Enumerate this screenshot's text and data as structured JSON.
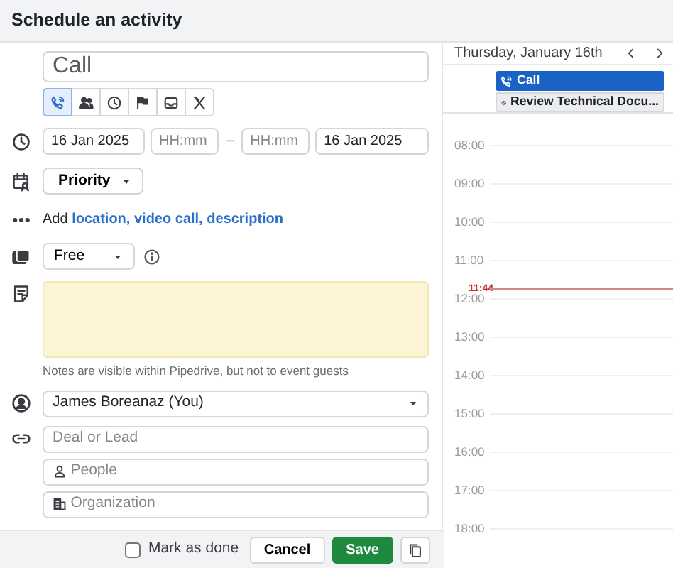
{
  "dialog": {
    "title": "Schedule an activity"
  },
  "form": {
    "subject": "Call",
    "activity_types": [
      {
        "kind": "call",
        "selected": true
      },
      {
        "kind": "meeting",
        "selected": false
      },
      {
        "kind": "task",
        "selected": false
      },
      {
        "kind": "deadline",
        "selected": false
      },
      {
        "kind": "email",
        "selected": false
      },
      {
        "kind": "lunch",
        "selected": false
      }
    ],
    "start_date": "16 Jan 2025",
    "start_time": {
      "placeholder": "HH:mm"
    },
    "separator": "–",
    "end_time": {
      "placeholder": "HH:mm"
    },
    "end_date": "16 Jan 2025",
    "priority": "Priority",
    "add_line": {
      "prefix": "Add",
      "links": [
        "location,",
        "video call,",
        "description"
      ]
    },
    "availability": "Free",
    "notes_hint": "Notes are visible within Pipedrive, but not to event guests",
    "owner": "James Boreanaz (You)",
    "deal": {
      "placeholder": "Deal or Lead"
    },
    "people": {
      "placeholder": "People"
    },
    "organization": {
      "placeholder": "Organization"
    }
  },
  "footer": {
    "mark_as_done": {
      "label": "Mark as done",
      "checked": false
    },
    "cancel": "Cancel",
    "save": "Save"
  },
  "calendar": {
    "date": "Thursday, January 16th",
    "events": [
      {
        "kind": "call",
        "title": "Call",
        "selected": true
      },
      {
        "kind": "task",
        "title": "Review Technical Docu...",
        "selected": false
      }
    ],
    "hours": [
      "08:00",
      "09:00",
      "10:00",
      "11:00",
      "12:00",
      "13:00",
      "14:00",
      "15:00",
      "16:00",
      "17:00",
      "18:00"
    ],
    "now": "11:44"
  }
}
